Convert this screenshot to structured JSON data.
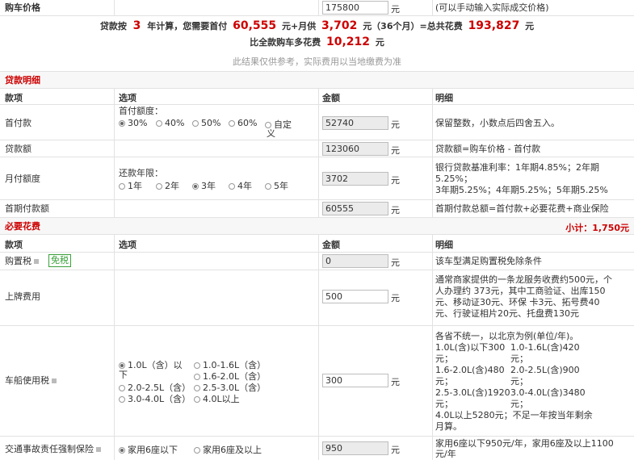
{
  "price_row": {
    "label": "购车价格",
    "value": "175800",
    "unit": "元",
    "hint": "(可以手动输入实际成交价格)"
  },
  "summary": {
    "line1": {
      "p1": "贷款按",
      "years": "3",
      "p2": "年计算，您需要首付",
      "down": "60,555",
      "p3": "元+月供",
      "monthly": "3,702",
      "p4": "元（36个月）=总共花费",
      "total": "193,827",
      "p5": "元"
    },
    "line2": {
      "p1": "比全款购车多花费",
      "extra": "10,212",
      "p2": "元"
    },
    "note": "此结果仅供参考，实际费用以当地缴费为准"
  },
  "loan": {
    "title": "贷款明细",
    "headers": {
      "item": "款项",
      "option": "选项",
      "amount": "金额",
      "detail": "明细"
    },
    "rows": {
      "down": {
        "label": "首付款",
        "sub": "首付额度：",
        "opts": [
          "30%",
          "40%",
          "50%",
          "60%",
          "自定",
          "义"
        ],
        "value": "52740",
        "unit": "元",
        "detail": "保留整数，小数点后四舍五入。"
      },
      "amount": {
        "label": "贷款额",
        "value": "123060",
        "unit": "元",
        "detail": "贷款额=购车价格 - 首付款"
      },
      "monthly": {
        "label": "月付额度",
        "sub": "还款年限：",
        "opts": [
          "1年",
          "2年",
          "3年",
          "4年",
          "5年"
        ],
        "value": "3702",
        "unit": "元",
        "detail": [
          "银行贷款基准利率：1年期4.85%；2年期",
          "5.25%；",
          "3年期5.25%；4年期5.25%；5年期5.25%"
        ]
      },
      "first": {
        "label": "首期付款额",
        "value": "60555",
        "unit": "元",
        "detail": "首期付款总额=首付款+必要花费+商业保险"
      }
    }
  },
  "required": {
    "title": "必要花费",
    "subtotal": "小计：1,750元",
    "headers": {
      "item": "款项",
      "option": "选项",
      "amount": "金额",
      "detail": "明细"
    },
    "rows": {
      "tax": {
        "label": "购置税",
        "badge": "免税",
        "value": "0",
        "unit": "元",
        "detail": "该车型满足购置税免除条件"
      },
      "plate": {
        "label": "上牌费用",
        "value": "500",
        "unit": "元",
        "detail": [
          "通常商家提供的一条龙服务收费约500元，个",
          "人办理约 373元，其中工商验证、出库150",
          "元、移动证30元、环保 卡3元、拓号费40",
          "元、行驶证相片20元、托盘费130元"
        ]
      },
      "vehicle": {
        "label": "车船使用税",
        "opts": [
          "1.0L（含）以",
          "下",
          "1.0-1.6L（含）",
          "1.6-2.0L（含）",
          "2.0-2.5L（含）",
          "2.5-3.0L（含）",
          "3.0-4.0L（含）",
          "4.0L以上"
        ],
        "value": "300",
        "unit": "元",
        "detail": [
          "各省不统一，以北京为例(单位/年)。",
          "1.0L(含)以下300",
          "1.0-1.6L(含)420",
          "元；",
          "元；",
          "1.6-2.0L(含)480",
          "2.0-2.5L(含)900",
          "元；",
          "元；",
          "2.5-3.0L(含)1920",
          "3.0-4.0L(含)3480",
          "元；",
          "元；",
          "4.0L以上5280元；不足一年按当年剩余",
          "月算。"
        ]
      },
      "insurance": {
        "label": "交通事故责任强制保险",
        "opts": [
          "家用6座以下",
          "家用6座及以上"
        ],
        "value": "950",
        "unit": "元",
        "detail": [
          "家用6座以下950元/年，家用6座及以上1100",
          "元/年"
        ]
      }
    }
  },
  "colors": {
    "accent": "#c00000",
    "badge": "#3aa03a"
  }
}
